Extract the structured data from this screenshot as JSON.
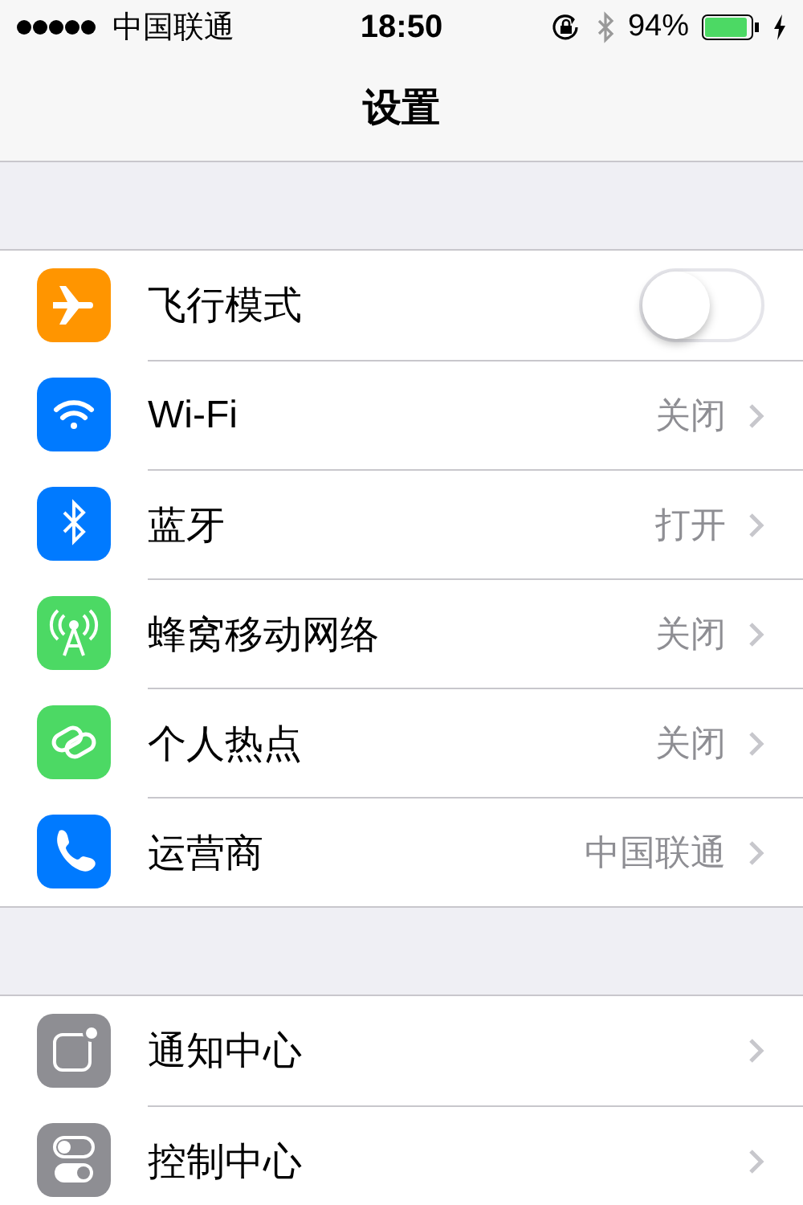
{
  "status_bar": {
    "carrier": "中国联通",
    "time": "18:50",
    "battery": "94%"
  },
  "title": "设置",
  "groups": [
    [
      {
        "kind": "toggle",
        "label": "飞行模式",
        "on": false,
        "color": "#ff9500"
      },
      {
        "kind": "link",
        "label": "Wi-Fi",
        "value": "关闭",
        "color": "#007aff"
      },
      {
        "kind": "link",
        "label": "蓝牙",
        "value": "打开",
        "color": "#007aff"
      },
      {
        "kind": "link",
        "label": "蜂窝移动网络",
        "value": "关闭",
        "color": "#4cd964"
      },
      {
        "kind": "link",
        "label": "个人热点",
        "value": "关闭",
        "color": "#4cd964"
      },
      {
        "kind": "link",
        "label": "运营商",
        "value": "中国联通",
        "color": "#007aff"
      }
    ],
    [
      {
        "kind": "link",
        "label": "通知中心",
        "color": "#8e8e93"
      },
      {
        "kind": "link",
        "label": "控制中心",
        "color": "#8e8e93"
      }
    ]
  ]
}
